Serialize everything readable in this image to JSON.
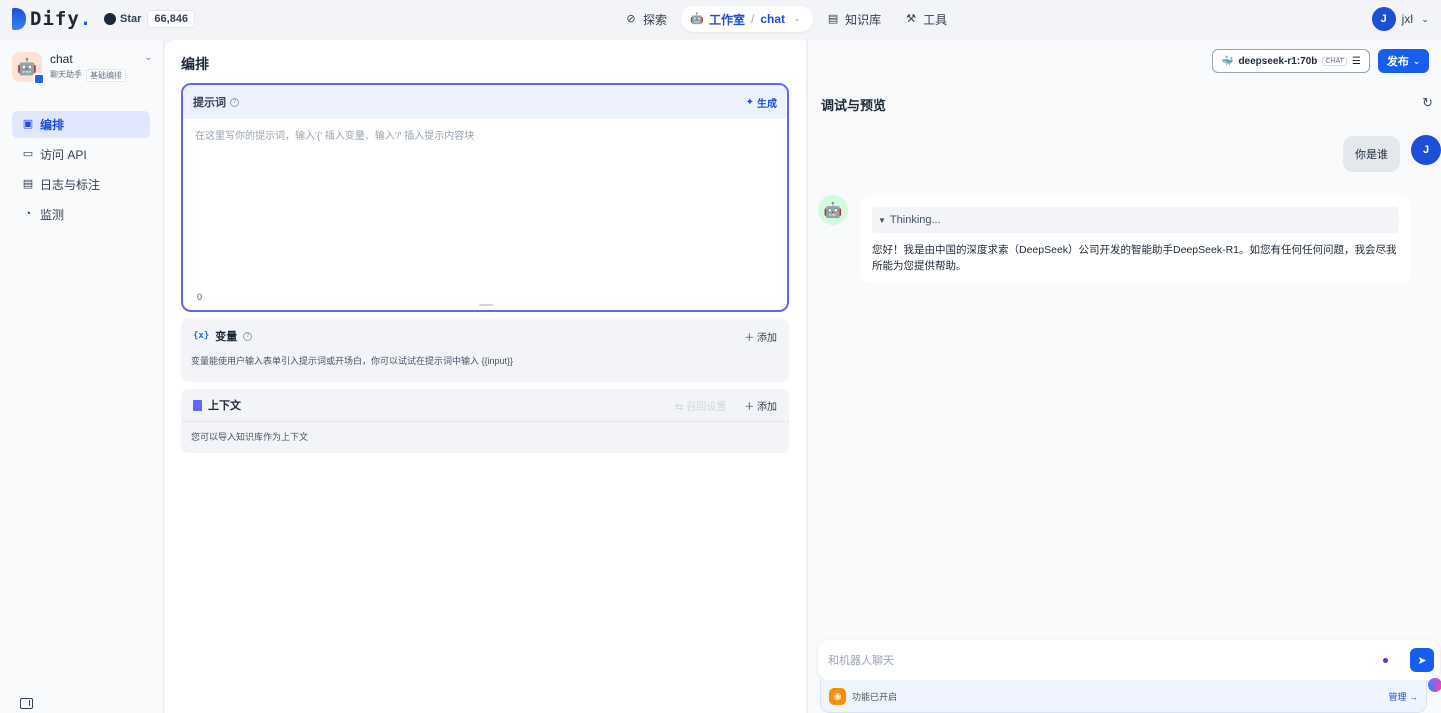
{
  "brand": {
    "name": "Dify",
    "dot": "."
  },
  "github": {
    "star_label": "Star",
    "count": "66,846"
  },
  "nav": {
    "explore": "探索",
    "studio": "工作室",
    "separator": "/",
    "current_app": "chat",
    "knowledge": "知识库",
    "tools": "工具"
  },
  "user": {
    "initial": "J",
    "name": "jxl"
  },
  "sidebar": {
    "app_name": "chat",
    "tags": [
      "聊天助手",
      "基础编排"
    ],
    "items": [
      {
        "label": "编排",
        "icon": "layout-icon"
      },
      {
        "label": "访问 API",
        "icon": "terminal-icon"
      },
      {
        "label": "日志与标注",
        "icon": "file-list-icon"
      },
      {
        "label": "监测",
        "icon": "monitor-icon"
      }
    ]
  },
  "orchestrate": {
    "title": "编排",
    "prompt": {
      "label": "提示词",
      "generate_label": "生成",
      "placeholder": "在这里写你的提示词，输入'{' 插入变量、输入'/' 插入提示内容块",
      "char_count": "0"
    },
    "variables": {
      "title": "变量",
      "icon_text": "{x}",
      "add_label": "添加",
      "description": "变量能使用户输入表单引入提示词或开场白，你可以试试在提示词中输入 {{input}}"
    },
    "context": {
      "title": "上下文",
      "recall_label": "召回设置",
      "add_label": "添加",
      "description": "您可以导入知识库作为上下文"
    }
  },
  "model": {
    "name": "deepseek-r1:70b",
    "mode": "CHAT"
  },
  "publish_label": "发布",
  "debug": {
    "title": "调试与预览",
    "user_message": "你是谁",
    "thinking_label": "Thinking...",
    "bot_answer": "您好！我是由中国的深度求索（DeepSeek）公司开发的智能助手DeepSeek-R1。如您有任何任何问题，我会尽我所能为您提供帮助。",
    "input_placeholder": "和机器人聊天",
    "features_label": "功能已开启",
    "manage_label": "管理"
  },
  "colors": {
    "accent": "#155eef",
    "prompt_border": "#6366f1",
    "studio_active": "#1d4ed8"
  }
}
